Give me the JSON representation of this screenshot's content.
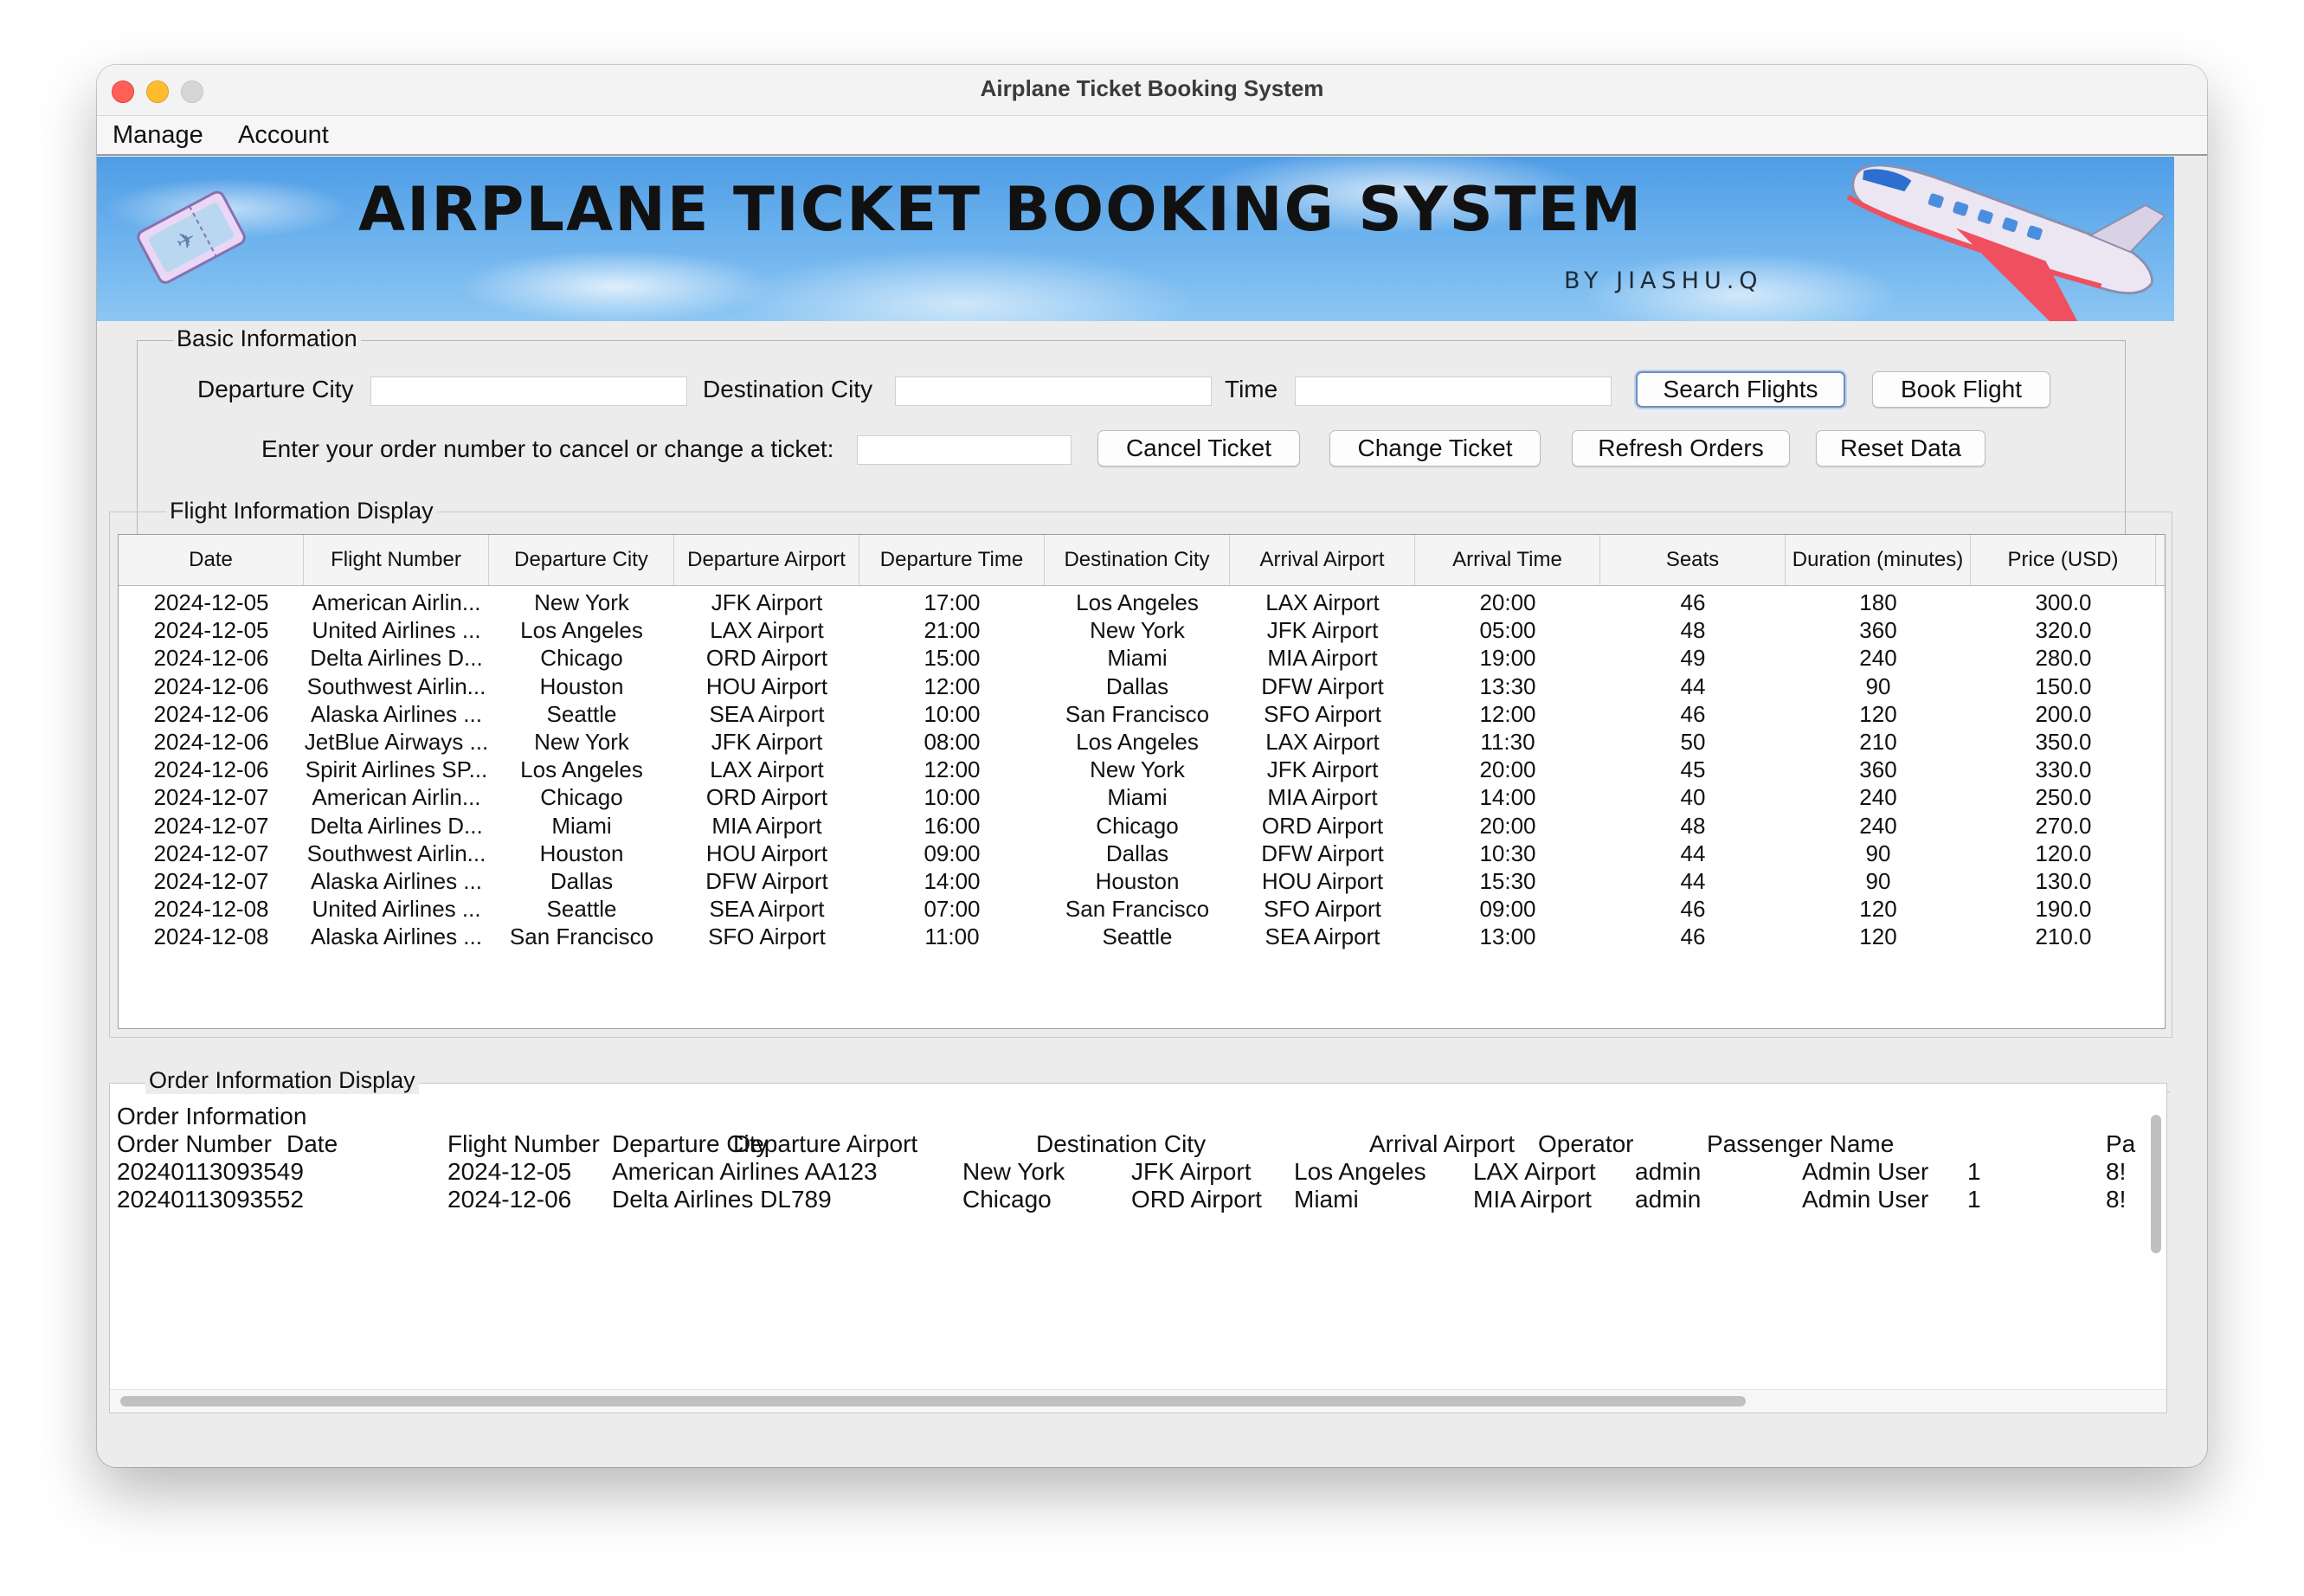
{
  "window": {
    "title": "Airplane Ticket Booking System"
  },
  "menu": {
    "manage": "Manage",
    "account": "Account"
  },
  "banner": {
    "title": "AIRPLANE TICKET BOOKING SYSTEM",
    "subtitle": "BY JIASHU.Q"
  },
  "basic": {
    "legend": "Basic Information",
    "departure_city_label": "Departure City",
    "destination_city_label": "Destination City",
    "time_label": "Time",
    "departure_city_value": "",
    "destination_city_value": "",
    "time_value": "",
    "order_label": "Enter your order number to cancel or change a ticket:",
    "order_value": "",
    "buttons": {
      "search": "Search Flights",
      "book": "Book Flight",
      "cancel": "Cancel Ticket",
      "change": "Change Ticket",
      "refresh": "Refresh Orders",
      "reset": "Reset Data"
    }
  },
  "flights": {
    "legend": "Flight Information Display",
    "columns": [
      "Date",
      "Flight Number",
      "Departure City",
      "Departure Airport",
      "Departure Time",
      "Destination City",
      "Arrival Airport",
      "Arrival Time",
      "Seats",
      "Duration (minutes)",
      "Price (USD)"
    ],
    "rows": [
      [
        "2024-12-05",
        "American Airlin...",
        "New York",
        "JFK Airport",
        "17:00",
        "Los Angeles",
        "LAX Airport",
        "20:00",
        "46",
        "180",
        "300.0"
      ],
      [
        "2024-12-05",
        "United Airlines ...",
        "Los Angeles",
        "LAX Airport",
        "21:00",
        "New York",
        "JFK Airport",
        "05:00",
        "48",
        "360",
        "320.0"
      ],
      [
        "2024-12-06",
        "Delta Airlines D...",
        "Chicago",
        "ORD Airport",
        "15:00",
        "Miami",
        "MIA Airport",
        "19:00",
        "49",
        "240",
        "280.0"
      ],
      [
        "2024-12-06",
        "Southwest Airlin...",
        "Houston",
        "HOU Airport",
        "12:00",
        "Dallas",
        "DFW Airport",
        "13:30",
        "44",
        "90",
        "150.0"
      ],
      [
        "2024-12-06",
        "Alaska Airlines ...",
        "Seattle",
        "SEA Airport",
        "10:00",
        "San Francisco",
        "SFO Airport",
        "12:00",
        "46",
        "120",
        "200.0"
      ],
      [
        "2024-12-06",
        "JetBlue Airways ...",
        "New York",
        "JFK Airport",
        "08:00",
        "Los Angeles",
        "LAX Airport",
        "11:30",
        "50",
        "210",
        "350.0"
      ],
      [
        "2024-12-06",
        "Spirit Airlines SP...",
        "Los Angeles",
        "LAX Airport",
        "12:00",
        "New York",
        "JFK Airport",
        "20:00",
        "45",
        "360",
        "330.0"
      ],
      [
        "2024-12-07",
        "American Airlin...",
        "Chicago",
        "ORD Airport",
        "10:00",
        "Miami",
        "MIA Airport",
        "14:00",
        "40",
        "240",
        "250.0"
      ],
      [
        "2024-12-07",
        "Delta Airlines D...",
        "Miami",
        "MIA Airport",
        "16:00",
        "Chicago",
        "ORD Airport",
        "20:00",
        "48",
        "240",
        "270.0"
      ],
      [
        "2024-12-07",
        "Southwest Airlin...",
        "Houston",
        "HOU Airport",
        "09:00",
        "Dallas",
        "DFW Airport",
        "10:30",
        "44",
        "90",
        "120.0"
      ],
      [
        "2024-12-07",
        "Alaska Airlines ...",
        "Dallas",
        "DFW Airport",
        "14:00",
        "Houston",
        "HOU Airport",
        "15:30",
        "44",
        "90",
        "130.0"
      ],
      [
        "2024-12-08",
        "United Airlines ...",
        "Seattle",
        "SEA Airport",
        "07:00",
        "San Francisco",
        "SFO Airport",
        "09:00",
        "46",
        "120",
        "190.0"
      ],
      [
        "2024-12-08",
        "Alaska Airlines ...",
        "San Francisco",
        "SFO Airport",
        "11:00",
        "Seattle",
        "SEA Airport",
        "13:00",
        "46",
        "120",
        "210.0"
      ]
    ]
  },
  "orders": {
    "legend": "Order Information Display",
    "heading": "Order Information",
    "header_line": [
      "Order Number",
      "Date",
      "Flight Number",
      "Departure City",
      "Departure Airport",
      "Destination City",
      "Arrival Airport",
      "Operator",
      "Passenger Name",
      "Pa"
    ],
    "rows": [
      [
        "20240113093549",
        "2024-12-05",
        "American Airlines AA123",
        "New York",
        "JFK Airport",
        "Los Angeles",
        "LAX Airport",
        "admin",
        "Admin User",
        "1",
        "8!"
      ],
      [
        "20240113093552",
        "2024-12-06",
        "Delta Airlines DL789",
        "Chicago",
        "ORD Airport",
        "Miami",
        "MIA Airport",
        "admin",
        "Admin User",
        "1",
        "8!"
      ]
    ]
  }
}
